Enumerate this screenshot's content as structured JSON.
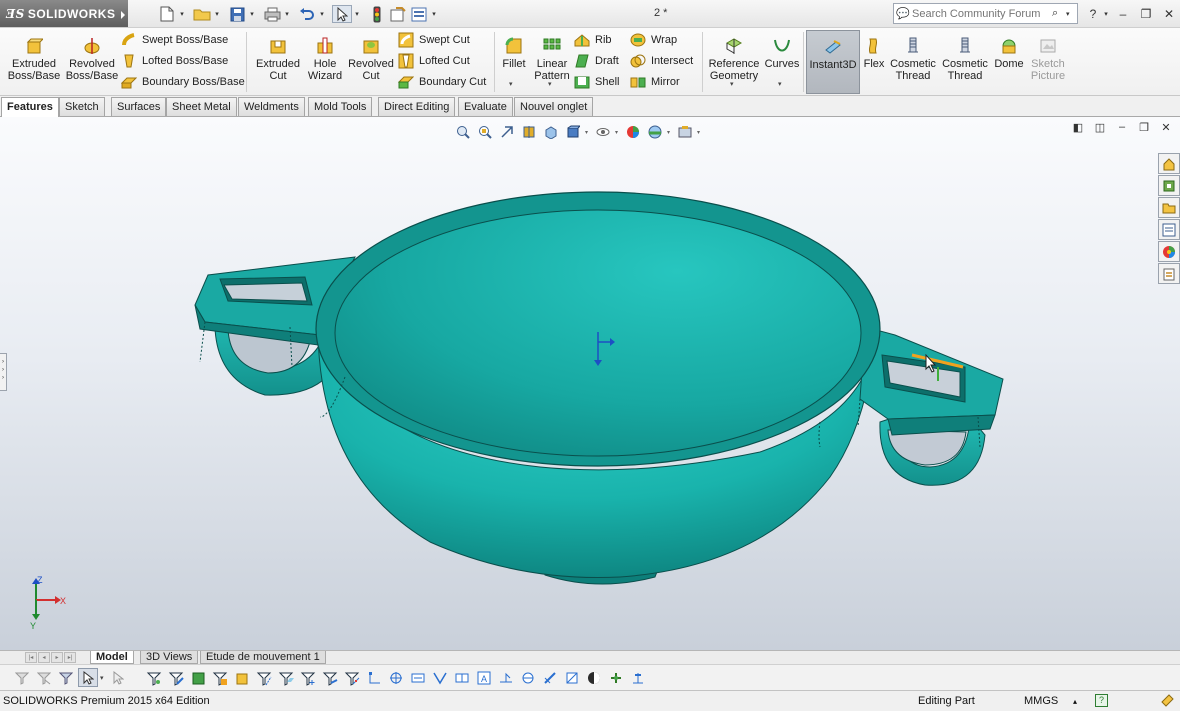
{
  "app": {
    "brand": "SOLIDWORKS",
    "doc_title": "2 *"
  },
  "search": {
    "placeholder": "Search Community Forum"
  },
  "ribbon": {
    "extruded_boss": "Extruded Boss/Base",
    "revolved_boss": "Revolved Boss/Base",
    "swept_boss": "Swept Boss/Base",
    "lofted_boss": "Lofted Boss/Base",
    "boundary_boss": "Boundary Boss/Base",
    "extruded_cut": "Extruded Cut",
    "hole_wizard": "Hole Wizard",
    "revolved_cut": "Revolved Cut",
    "swept_cut": "Swept Cut",
    "lofted_cut": "Lofted Cut",
    "boundary_cut": "Boundary Cut",
    "fillet": "Fillet",
    "linear_pattern": "Linear Pattern",
    "rib": "Rib",
    "draft": "Draft",
    "shell": "Shell",
    "wrap": "Wrap",
    "intersect": "Intersect",
    "mirror": "Mirror",
    "reference_geometry": "Reference Geometry",
    "curves": "Curves",
    "instant3d": "Instant3D",
    "flex": "Flex",
    "cosmetic_thread_1": "Cosmetic Thread",
    "cosmetic_thread_2": "Cosmetic Thread",
    "dome": "Dome",
    "sketch_picture": "Sketch Picture"
  },
  "tabs": [
    "Features",
    "Sketch",
    "Surfaces",
    "Sheet Metal",
    "Weldments",
    "Mold Tools",
    "Direct Editing",
    "Evaluate",
    "Nouvel onglet"
  ],
  "bottom_tabs": [
    "Model",
    "3D Views",
    "Etude de mouvement 1"
  ],
  "triad": {
    "x": "X",
    "y": "Y",
    "z": "Z"
  },
  "status": {
    "edition": "SOLIDWORKS Premium 2015 x64 Edition",
    "mode": "Editing Part",
    "units": "MMGS",
    "help": "?"
  },
  "colors": {
    "model": "#1fb7b0",
    "model_edge": "#0e5f5c",
    "active_tool": "#b9bec5"
  }
}
